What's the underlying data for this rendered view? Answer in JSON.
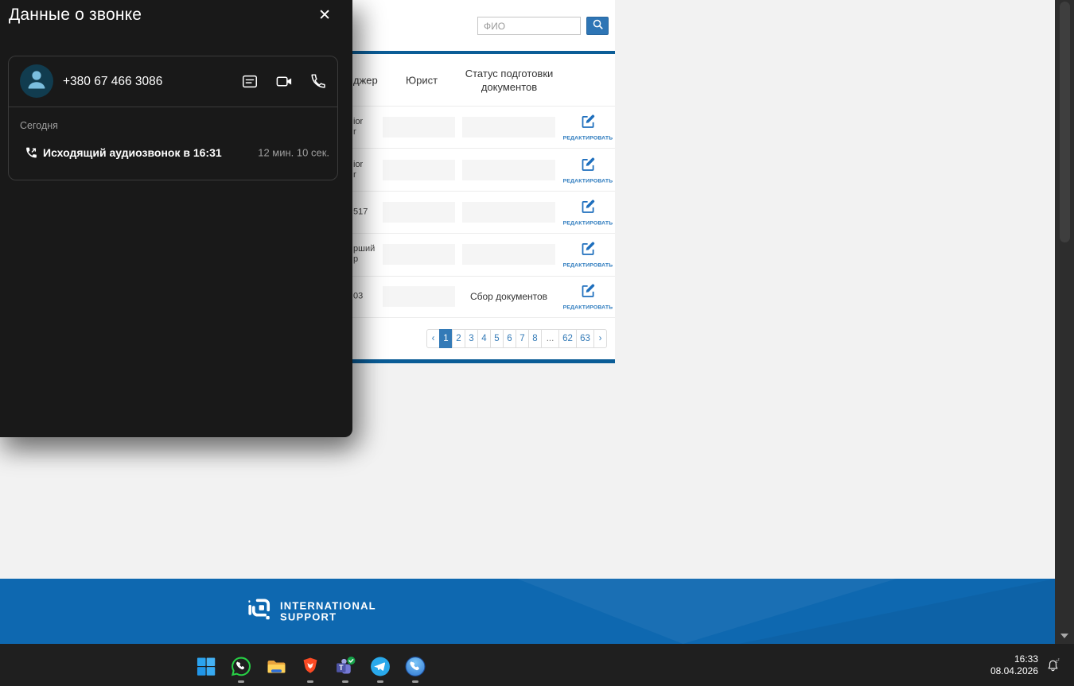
{
  "call_panel": {
    "title": "Данные о звонке",
    "close_glyph": "✕",
    "contact": {
      "phone": "+380 67 466 3086",
      "avatar_icon": "person-icon"
    },
    "action_icons": [
      "message-icon",
      "video-call-icon",
      "voice-call-icon"
    ],
    "history": {
      "day_label": "Сегодня",
      "entry": {
        "icon": "outgoing-call-icon",
        "text": "Исходящий аудиозвонок в 16:31",
        "duration": "12 мин. 10 сек."
      }
    }
  },
  "webpage": {
    "search": {
      "placeholder": "ФИО",
      "button_icon": "search-icon"
    },
    "table": {
      "header": {
        "manager_fragment": "джер",
        "lawyer": "Юрист",
        "status": "Статус подготовки документов"
      },
      "edit_label": "РЕДАКТИРОВАТЬ",
      "rows": [
        {
          "fragment": "ior\nr",
          "status": ""
        },
        {
          "fragment": "ior\nr",
          "status": ""
        },
        {
          "fragment": "517",
          "status": ""
        },
        {
          "fragment": "рший\nр",
          "status": ""
        },
        {
          "fragment": "03",
          "status": "Сбор документов"
        }
      ]
    },
    "pagination": {
      "prev": "‹",
      "next": "›",
      "pages": [
        "1",
        "2",
        "3",
        "4",
        "5",
        "6",
        "7",
        "8",
        "...",
        "62",
        "63"
      ],
      "active_page": "1"
    }
  },
  "footer": {
    "brand_line1": "INTERNATIONAL",
    "brand_line2": "SUPPORT"
  },
  "taskbar": {
    "apps": [
      "start",
      "whatsapp",
      "file-explorer",
      "brave",
      "teams",
      "telegram",
      "phone-app"
    ],
    "running_apps": [
      "whatsapp",
      "brave",
      "teams",
      "telegram",
      "phone-app"
    ],
    "clock": {
      "time": "16:33",
      "date": "08.04.2026"
    },
    "tray_icon": "notification-bell-zzz-icon"
  },
  "colors": {
    "accent_blue": "#2e75b5",
    "deep_blue": "#0b5d97",
    "active_page_blue": "#337ab7",
    "edit_blue": "#1e6fbd",
    "footer_blue": "#0e68b0",
    "panel_bg": "#191919",
    "taskbar_bg": "#1f1f1f"
  }
}
